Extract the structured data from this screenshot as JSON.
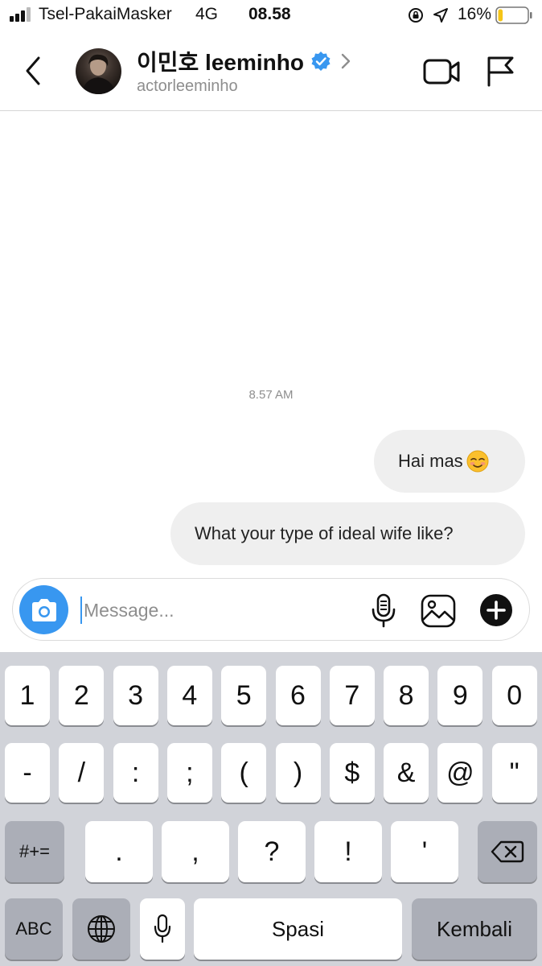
{
  "status_bar": {
    "carrier": "Tsel-PakaiMasker",
    "network": "4G",
    "time": "08.58",
    "battery_percent": "16%",
    "battery_level": 0.16,
    "icons": [
      "signal-icon",
      "rotation-lock-icon",
      "location-arrow-icon",
      "battery-icon"
    ]
  },
  "header": {
    "display_name": "이민호 leeminho",
    "username": "actorleeminho",
    "verified": true,
    "icons": [
      "back-chevron-icon",
      "avatar",
      "verified-badge-icon",
      "chevron-right-icon",
      "video-call-icon",
      "flag-icon"
    ]
  },
  "chat": {
    "timestamp": "8.57 AM",
    "messages": [
      {
        "text": "Hai mas",
        "emoji": "smiling-face-icon",
        "from": "me"
      },
      {
        "text": "What your type of ideal wife like?",
        "from": "me"
      }
    ]
  },
  "composer": {
    "placeholder": "Message...",
    "value": "",
    "icons": [
      "camera-icon",
      "microphone-icon",
      "gallery-icon",
      "plus-icon"
    ]
  },
  "keyboard": {
    "row1": [
      "1",
      "2",
      "3",
      "4",
      "5",
      "6",
      "7",
      "8",
      "9",
      "0"
    ],
    "row2": [
      "-",
      "/",
      ":",
      ";",
      "(",
      ")",
      "$",
      "&",
      "@",
      "\""
    ],
    "row3_left": "#+=",
    "row3": [
      ".",
      ",",
      "?",
      "!",
      "'"
    ],
    "row3_right_icon": "backspace-icon",
    "row4_left": "ABC",
    "row4_globe_icon": "globe-icon",
    "row4_mic_icon": "microphone-icon",
    "space": "Spasi",
    "return": "Kembali"
  },
  "colors": {
    "accent": "#3897f0",
    "bubble": "#efefef",
    "keyboard_bg": "#d1d3d9",
    "key_dark": "#abaeb7",
    "battery_fill": "#f5c518"
  }
}
